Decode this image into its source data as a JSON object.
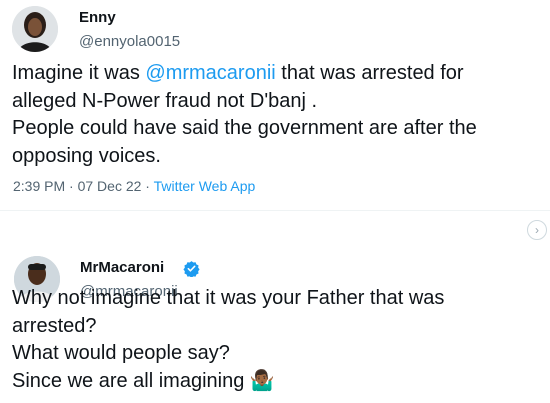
{
  "tweets": [
    {
      "display_name": "Enny",
      "handle": "@ennyola0015",
      "body": {
        "line1_a": "Imagine it was ",
        "line1_mention": "@mrmacaronii",
        "line1_b": " that was arrested for",
        "line2": "alleged N-Power fraud not D'banj .",
        "line3": "People could have said the government are after the",
        "line4": "opposing voices."
      },
      "timestamp": "2:39 PM · 07 Dec 22 · ",
      "client": "Twitter Web App"
    },
    {
      "display_name": "MrMacaroni",
      "handle": "@mrmacaronii",
      "verified": true,
      "body": {
        "line1": "Why not imagine that it was your Father that was",
        "line2": "arrested?",
        "line3": "What would people say?",
        "line4": "Since we are all imagining 🤷🏾‍♂️"
      }
    }
  ],
  "icons": {
    "chevron": "chevron-right-icon",
    "verified": "verified-badge-icon"
  },
  "colors": {
    "link": "#1d9bf0",
    "text": "#0f1419",
    "muted": "#536471"
  }
}
